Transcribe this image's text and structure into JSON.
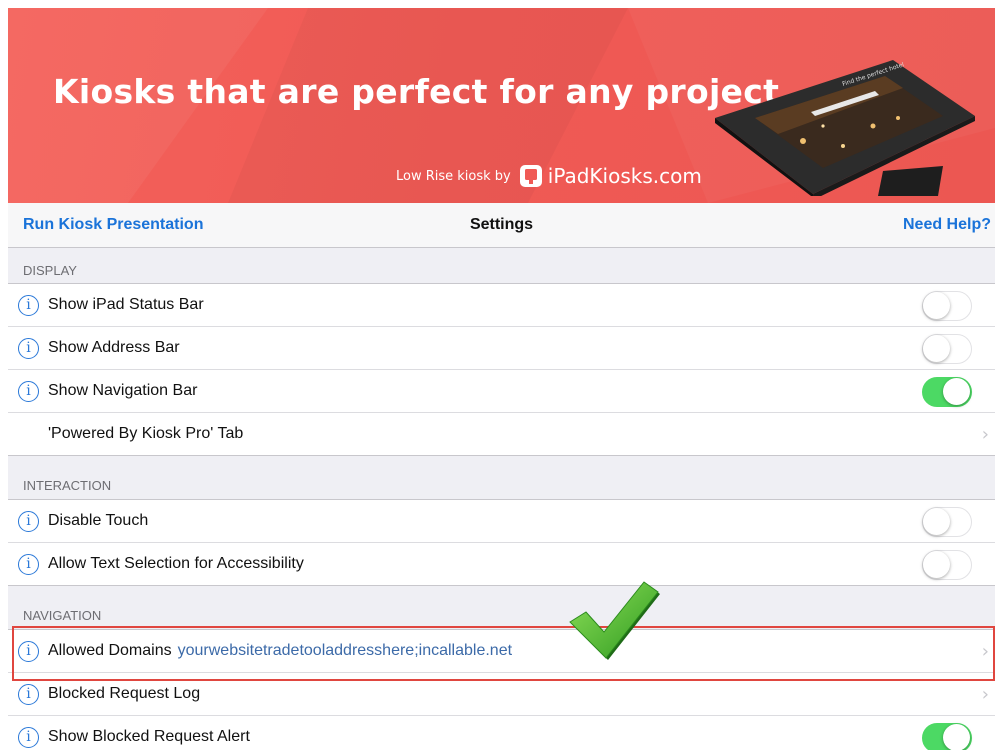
{
  "banner": {
    "headline": "Kiosks that are perfect for any project.",
    "credit_small": "Low Rise kiosk by",
    "credit_brand": "iPadKiosks.com",
    "screen_text": "Find the perfect hotel"
  },
  "navbar": {
    "left_link": "Run Kiosk Presentation",
    "title": "Settings",
    "right_link": "Need Help?"
  },
  "sections": [
    {
      "header": "DISPLAY",
      "rows": [
        {
          "label": "Show iPad Status Bar",
          "info": true,
          "control": "toggle",
          "on": false
        },
        {
          "label": "Show Address Bar",
          "info": true,
          "control": "toggle",
          "on": false
        },
        {
          "label": "Show Navigation Bar",
          "info": true,
          "control": "toggle",
          "on": true
        },
        {
          "label": "'Powered By Kiosk Pro' Tab",
          "info": false,
          "control": "chevron"
        }
      ]
    },
    {
      "header": "INTERACTION",
      "rows": [
        {
          "label": "Disable Touch",
          "info": true,
          "control": "toggle",
          "on": false
        },
        {
          "label": "Allow Text Selection for Accessibility",
          "info": true,
          "control": "toggle",
          "on": false
        }
      ]
    },
    {
      "header": "NAVIGATION",
      "rows": [
        {
          "label": "Allowed Domains",
          "value": "yourwebsitetradetooladdresshere;incallable.net",
          "info": true,
          "control": "chevron"
        },
        {
          "label": "Blocked Request Log",
          "info": true,
          "control": "chevron"
        },
        {
          "label": "Show Blocked Request Alert",
          "info": true,
          "control": "toggle",
          "on": true
        }
      ]
    }
  ],
  "colors": {
    "banner": "#f05a55",
    "link": "#1a73d9",
    "toggle_on": "#4cd964",
    "highlight": "#e0463f",
    "checkmark": "#3fb52b"
  },
  "icons": {
    "info": "i",
    "chevron": "›"
  }
}
